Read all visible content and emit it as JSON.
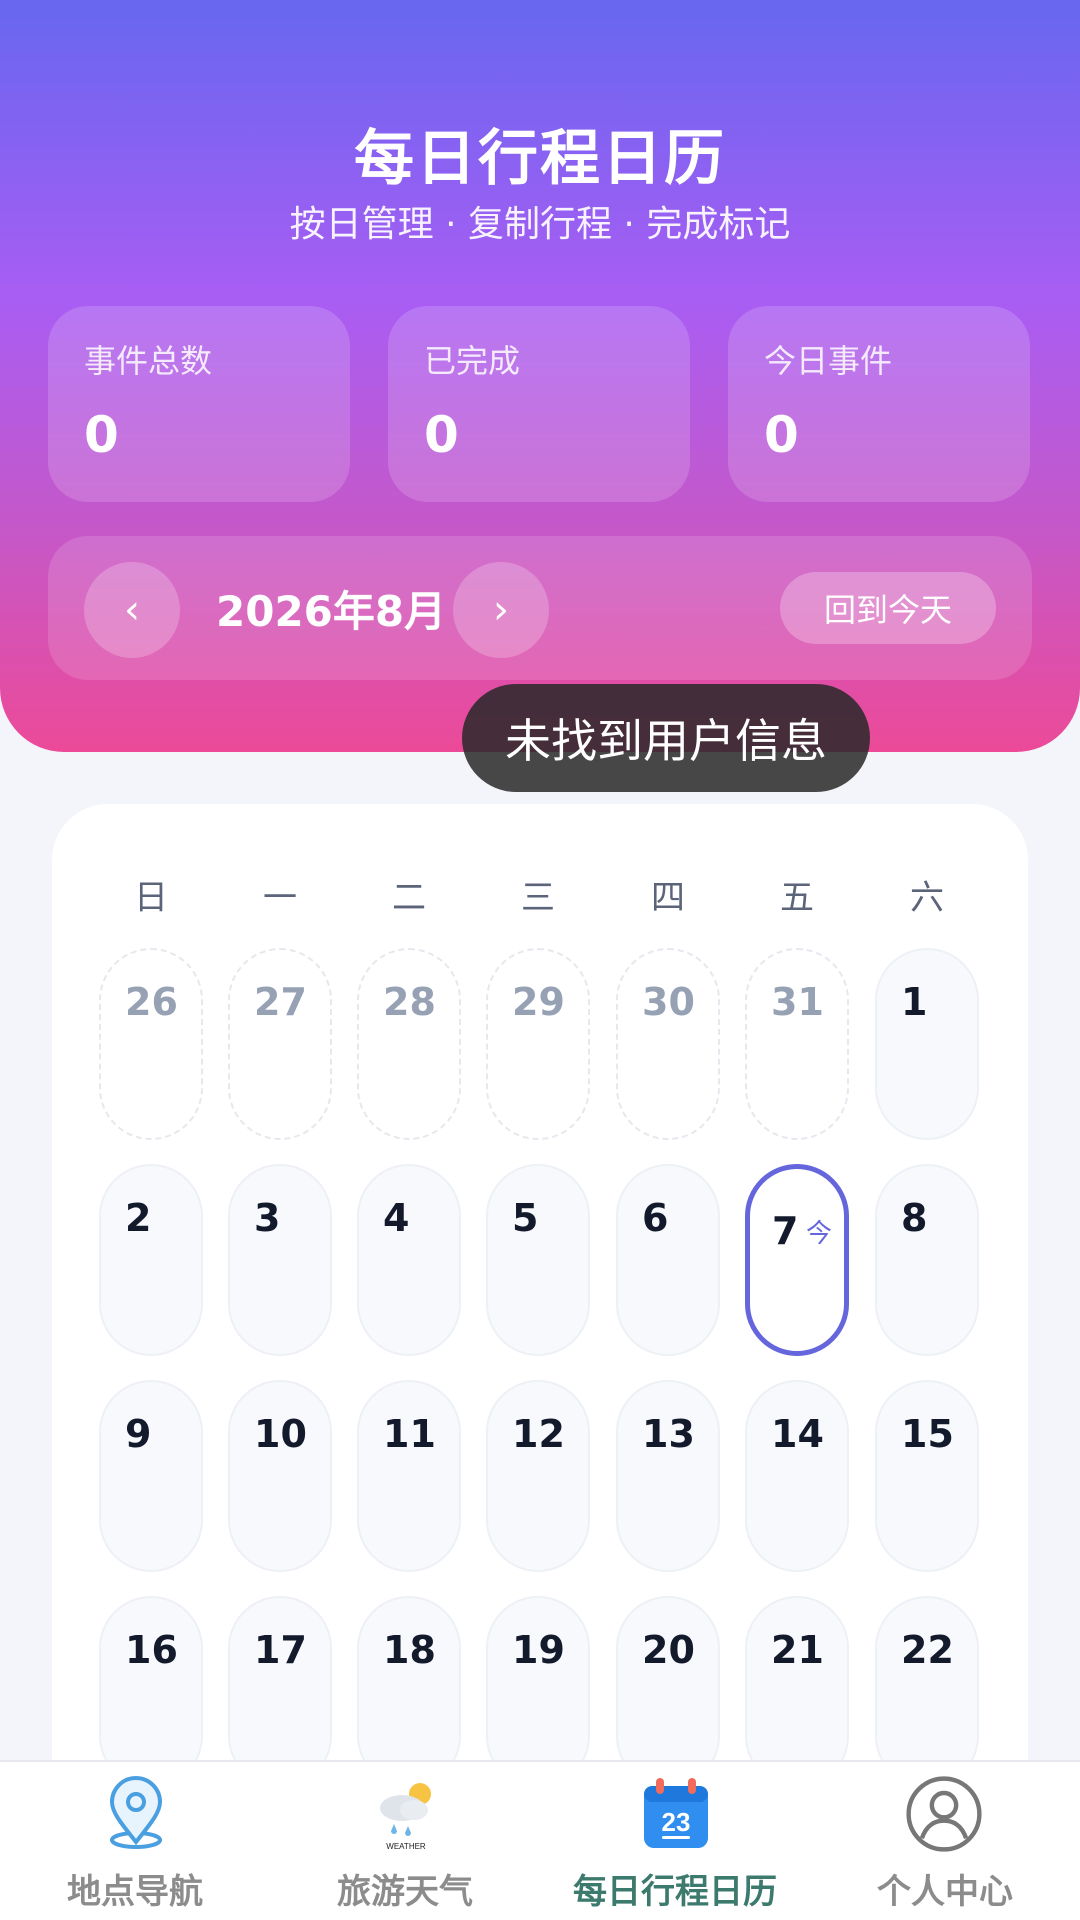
{
  "header": {
    "title": "每日行程日历",
    "subtitle": "按日管理 · 复制行程 · 完成标记"
  },
  "stats": [
    {
      "label": "事件总数",
      "value": "0"
    },
    {
      "label": "已完成",
      "value": "0"
    },
    {
      "label": "今日事件",
      "value": "0"
    }
  ],
  "month_nav": {
    "prev_icon": "chevron-left-icon",
    "next_icon": "chevron-right-icon",
    "prev_glyph": "‹",
    "next_glyph": "›",
    "month_label": "2026年8月",
    "today_button": "回到今天"
  },
  "toast": "未找到用户信息",
  "calendar": {
    "weekdays": [
      "日",
      "一",
      "二",
      "三",
      "四",
      "五",
      "六"
    ],
    "today_tag": "今",
    "weeks": [
      [
        {
          "d": "26",
          "other": true
        },
        {
          "d": "27",
          "other": true
        },
        {
          "d": "28",
          "other": true
        },
        {
          "d": "29",
          "other": true
        },
        {
          "d": "30",
          "other": true
        },
        {
          "d": "31",
          "other": true
        },
        {
          "d": "1"
        }
      ],
      [
        {
          "d": "2"
        },
        {
          "d": "3"
        },
        {
          "d": "4"
        },
        {
          "d": "5"
        },
        {
          "d": "6"
        },
        {
          "d": "7",
          "today": true
        },
        {
          "d": "8"
        }
      ],
      [
        {
          "d": "9"
        },
        {
          "d": "10"
        },
        {
          "d": "11"
        },
        {
          "d": "12"
        },
        {
          "d": "13"
        },
        {
          "d": "14"
        },
        {
          "d": "15"
        }
      ],
      [
        {
          "d": "16"
        },
        {
          "d": "17"
        },
        {
          "d": "18"
        },
        {
          "d": "19"
        },
        {
          "d": "20"
        },
        {
          "d": "21"
        },
        {
          "d": "22"
        }
      ]
    ]
  },
  "tabs": [
    {
      "label": "地点导航",
      "icon": "map-pin-icon"
    },
    {
      "label": "旅游天气",
      "icon": "weather-icon",
      "icon_text": "WEATHER"
    },
    {
      "label": "每日行程日历",
      "icon": "calendar-icon",
      "icon_text": "23",
      "active": true
    },
    {
      "label": "个人中心",
      "icon": "user-icon"
    }
  ],
  "colors": {
    "accent": "#6566dc",
    "active_tab": "#3d7a6e",
    "header_top": "#6767f0",
    "header_bottom": "#ec4a98"
  }
}
